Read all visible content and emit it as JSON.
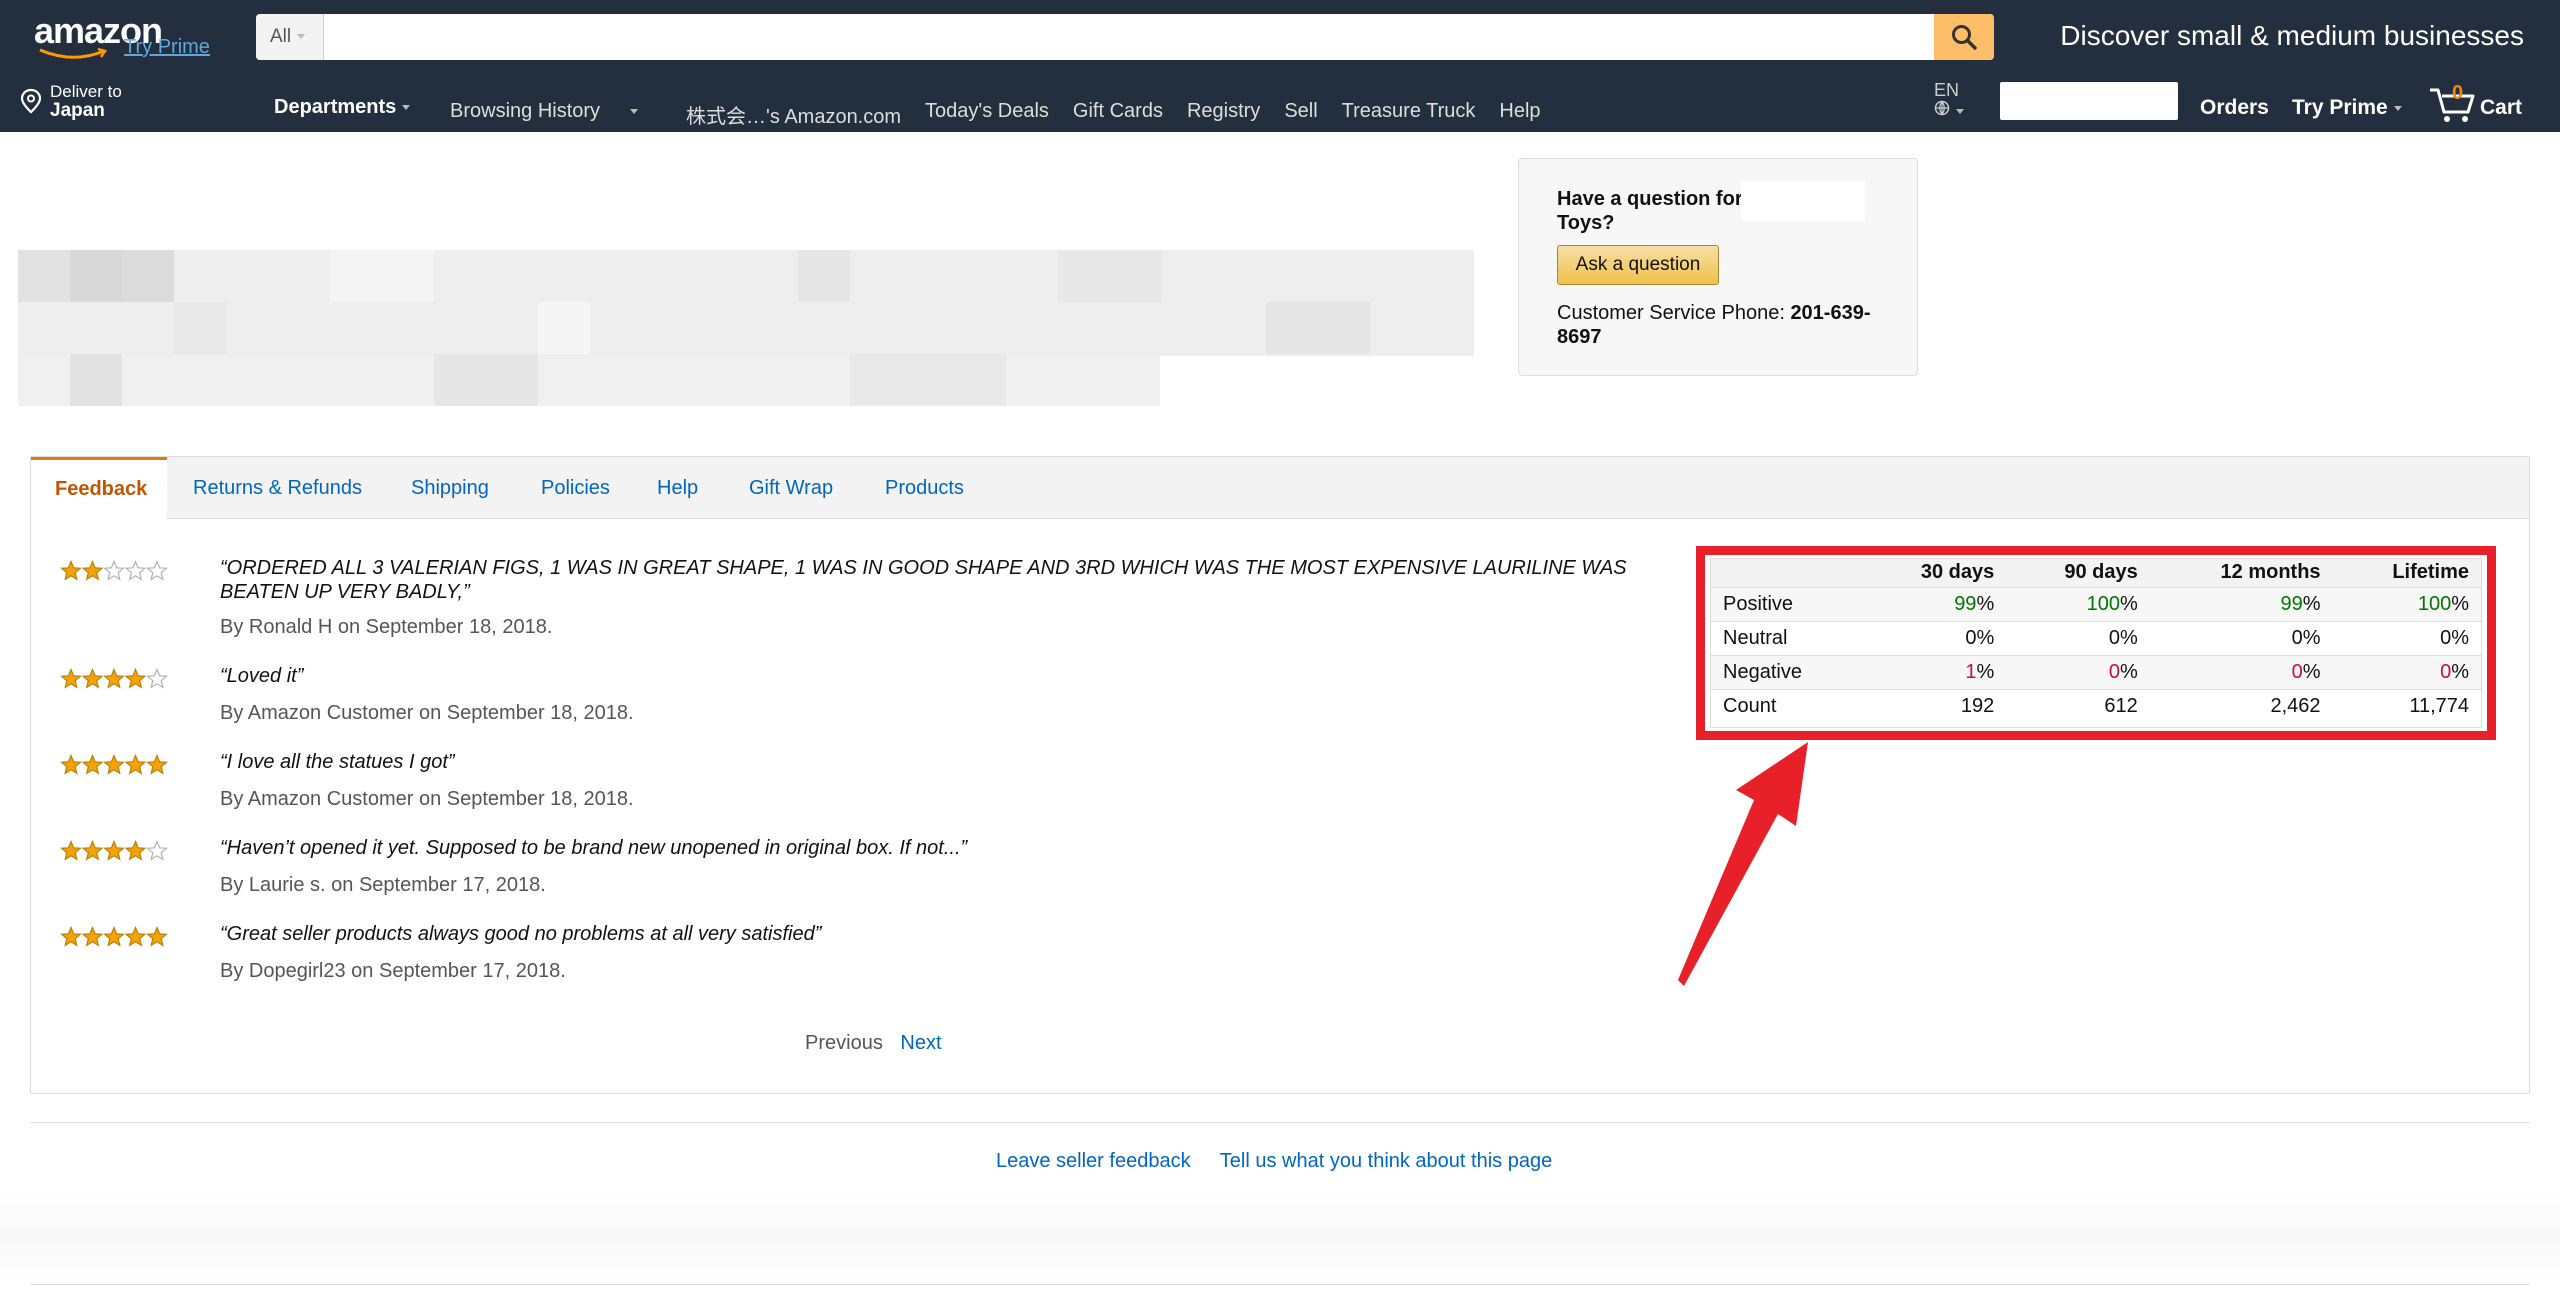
{
  "header": {
    "logo_text": "amazon",
    "try_prime": "Try Prime",
    "search_category": "All",
    "search_value": "",
    "promo": "Discover small & medium businesses",
    "deliver_line1": "Deliver to",
    "deliver_line2": "Japan",
    "departments": "Departments",
    "nav_links": [
      "Browsing History",
      "株式会…'s Amazon.com",
      "Today's Deals",
      "Gift Cards",
      "Registry",
      "Sell",
      "Treasure Truck",
      "Help"
    ],
    "lang": "EN",
    "orders": "Orders",
    "try_prime_menu": "Try Prime",
    "cart_count": "0",
    "cart_label": "Cart"
  },
  "question_box": {
    "question_line1": "Have a question for",
    "question_line2": "Toys?",
    "ask_button": "Ask a question",
    "phone_label": "Customer Service Phone: ",
    "phone_number": "201-639-8697"
  },
  "tabs": [
    "Feedback",
    "Returns & Refunds",
    "Shipping",
    "Policies",
    "Help",
    "Gift Wrap",
    "Products"
  ],
  "active_tab": "Feedback",
  "reviews": [
    {
      "stars": 2,
      "quote": "“ORDERED ALL 3 VALERIAN FIGS, 1 WAS IN GREAT SHAPE, 1 WAS IN GOOD SHAPE AND 3RD WHICH WAS THE MOST EXPENSIVE LAURILINE WAS BEATEN UP VERY BADLY,”",
      "byline": "By Ronald H on September 18, 2018."
    },
    {
      "stars": 4,
      "quote": "“Loved it”",
      "byline": "By Amazon Customer on September 18, 2018."
    },
    {
      "stars": 5,
      "quote": "“I love all the statues I got”",
      "byline": "By Amazon Customer on September 18, 2018."
    },
    {
      "stars": 4,
      "quote": "“Haven’t opened it yet. Supposed to be brand new unopened in original box. If not...”",
      "byline": "By Laurie s. on September 17, 2018."
    },
    {
      "stars": 5,
      "quote": "“Great seller products always good no problems at all very satisfied”",
      "byline": "By Dopegirl23 on September 17, 2018."
    }
  ],
  "pager": {
    "previous": "Previous",
    "next": "Next"
  },
  "stats": {
    "headers": [
      "",
      "30 days",
      "90 days",
      "12 months",
      "Lifetime"
    ],
    "rows": [
      {
        "label": "Positive",
        "values": [
          "99",
          "100",
          "99",
          "100"
        ],
        "suffix": "%",
        "color": "#007600"
      },
      {
        "label": "Neutral",
        "values": [
          "0",
          "0",
          "0",
          "0"
        ],
        "suffix": "%",
        "color": "#111111"
      },
      {
        "label": "Negative",
        "values": [
          "1",
          "0",
          "0",
          "0"
        ],
        "suffix": "%",
        "color": "#cc0c39"
      },
      {
        "label": "Count",
        "values": [
          "192",
          "612",
          "2,462",
          "11,774"
        ],
        "suffix": "",
        "color": "#111111"
      }
    ]
  },
  "footer": {
    "leave_feedback": "Leave seller feedback",
    "tell_us": "Tell us what you think about this page"
  },
  "colors": {
    "nav": "#232f3e",
    "accent": "#febd69",
    "link": "#0066c0",
    "highlight": "#e8202a",
    "star": "#f0a30a"
  }
}
